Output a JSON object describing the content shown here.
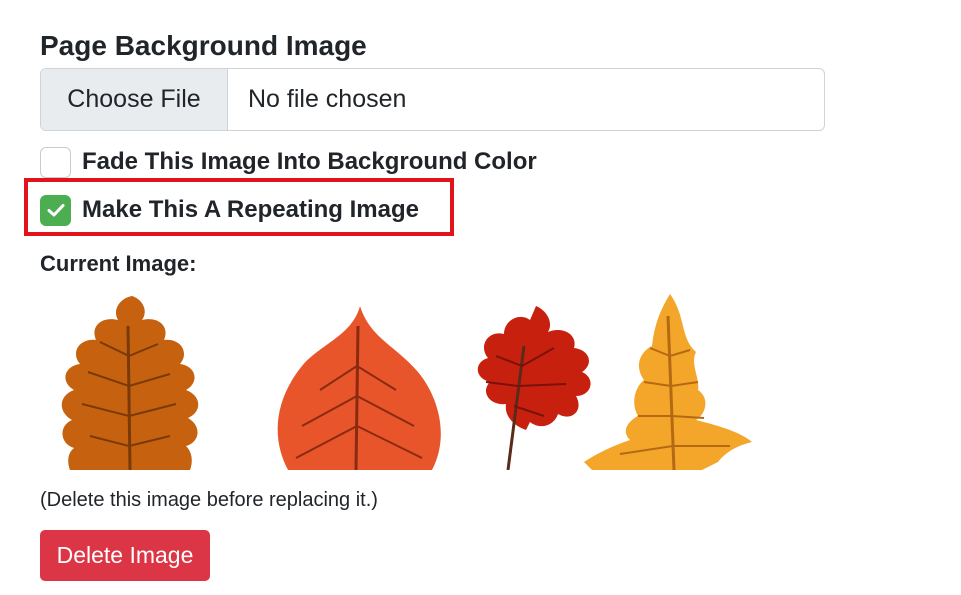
{
  "section": {
    "title": "Page Background Image"
  },
  "file_input": {
    "button_label": "Choose File",
    "status_text": "No file chosen"
  },
  "options": {
    "fade": {
      "label": "Fade This Image Into Background Color",
      "checked": false
    },
    "repeat": {
      "label": "Make This A Repeating Image",
      "checked": true
    }
  },
  "current_image": {
    "label": "Current Image:",
    "image_description_icon": "autumn-leaves-image",
    "note": "(Delete this image before replacing it.)"
  },
  "actions": {
    "delete_label": "Delete Image"
  },
  "colors": {
    "checked_green": "#4cae50",
    "highlight_red": "#e0141a",
    "danger": "#dc3545"
  }
}
